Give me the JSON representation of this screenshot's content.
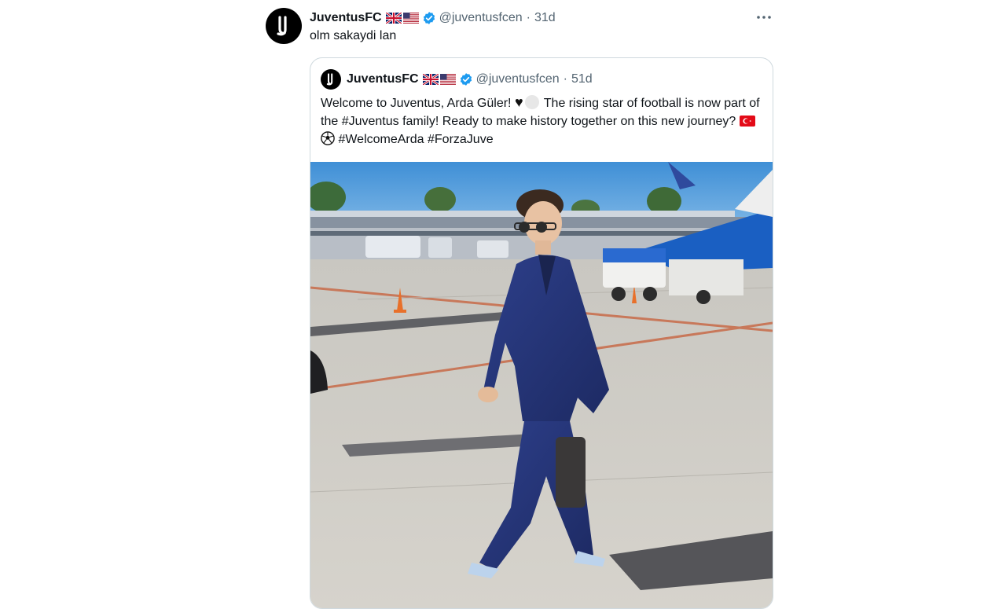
{
  "tweet": {
    "author_name": "JuventusFC",
    "handle": "@juventusfcen",
    "time": "31d",
    "text": "olm sakaydi lan",
    "more_icon": "ellipsis-icon"
  },
  "quoted": {
    "author_name": "JuventusFC",
    "handle": "@juventusfcen",
    "time": "51d",
    "text_part1": "Welcome to Juventus, Arda Güler! ",
    "text_part2": " The rising star of football is now part of the ",
    "hashtag1": "#Juventus",
    "text_part3": " family! Ready to make history together on this new journey? ",
    "hashtag2": "#WelcomeArda",
    "hashtag3": "#ForzaJuve",
    "image_alt": "Man in navy double-breasted suit walking on airport tarmac"
  },
  "colors": {
    "verified": "#1d9bf0",
    "muted": "#536471",
    "border": "#cfd9de"
  }
}
